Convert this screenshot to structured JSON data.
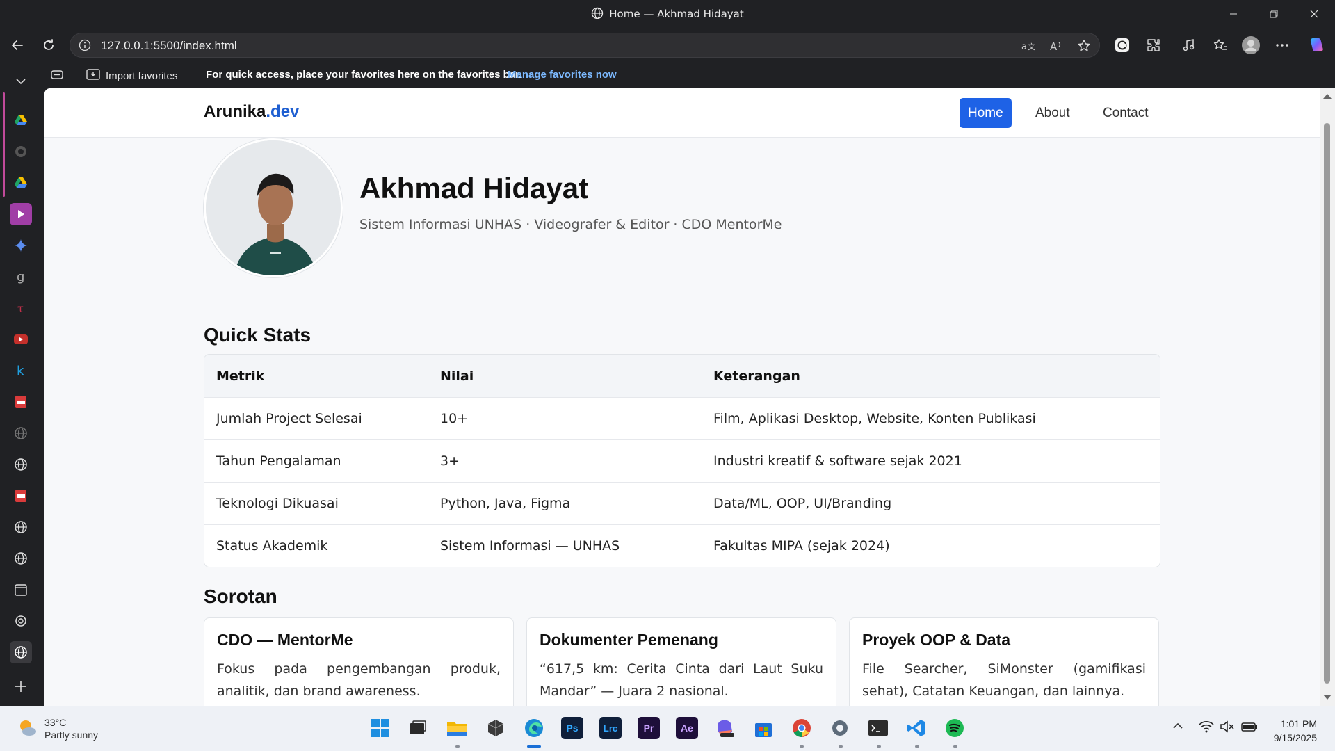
{
  "window": {
    "tab_title": "Home — Akhmad Hidayat"
  },
  "address_bar": {
    "url": "127.0.0.1:5500/index.html"
  },
  "favorites_bar": {
    "import_label": "Import favorites",
    "message": "For quick access, place your favorites here on the favorites bar.",
    "manage_link": "Manage favorites now"
  },
  "site": {
    "brand_name": "Arunika",
    "brand_suffix": ".dev",
    "brand_color": "#1f5fd1",
    "nav": [
      {
        "label": "Home",
        "active": true
      },
      {
        "label": "About",
        "active": false
      },
      {
        "label": "Contact",
        "active": false
      }
    ],
    "accent": "#1e62e6"
  },
  "hero": {
    "name": "Akhmad Hidayat",
    "subtitle": "Sistem Informasi UNHAS · Videografer & Editor · CDO MentorMe"
  },
  "quick_stats": {
    "title": "Quick Stats",
    "headers": [
      "Metrik",
      "Nilai",
      "Keterangan"
    ],
    "rows": [
      [
        "Jumlah Project Selesai",
        "10+",
        "Film, Aplikasi Desktop, Website, Konten Publikasi"
      ],
      [
        "Tahun Pengalaman",
        "3+",
        "Industri kreatif & software sejak 2021"
      ],
      [
        "Teknologi Dikuasai",
        "Python, Java, Figma",
        "Data/ML, OOP, UI/Branding"
      ],
      [
        "Status Akademik",
        "Sistem Informasi — UNHAS",
        "Fakultas MIPA (sejak 2024)"
      ]
    ]
  },
  "highlights": {
    "title": "Sorotan",
    "cards": [
      {
        "title": "CDO — MentorMe",
        "text": "Fokus pada pengembangan produk, analitik, dan brand awareness."
      },
      {
        "title": "Dokumenter Pemenang",
        "text": "“617,5 km: Cerita Cinta dari Laut Suku Mandar” — Juara 2 nasional."
      },
      {
        "title": "Proyek OOP & Data",
        "text": "File Searcher, SiMonster (gamifikasi sehat), Catatan Keuangan, dan lainnya."
      }
    ]
  },
  "taskbar": {
    "weather_temp": "33°C",
    "weather_desc": "Partly sunny",
    "apps": [
      "windows-start",
      "file-explorer-dark",
      "file-explorer",
      "unity",
      "edge",
      "Ps",
      "Lrc",
      "Pr",
      "Ae",
      "m365",
      "store",
      "chrome",
      "settings",
      "terminal",
      "vscode",
      "spotify"
    ],
    "time": "1:01 PM",
    "date": "9/15/2025"
  }
}
